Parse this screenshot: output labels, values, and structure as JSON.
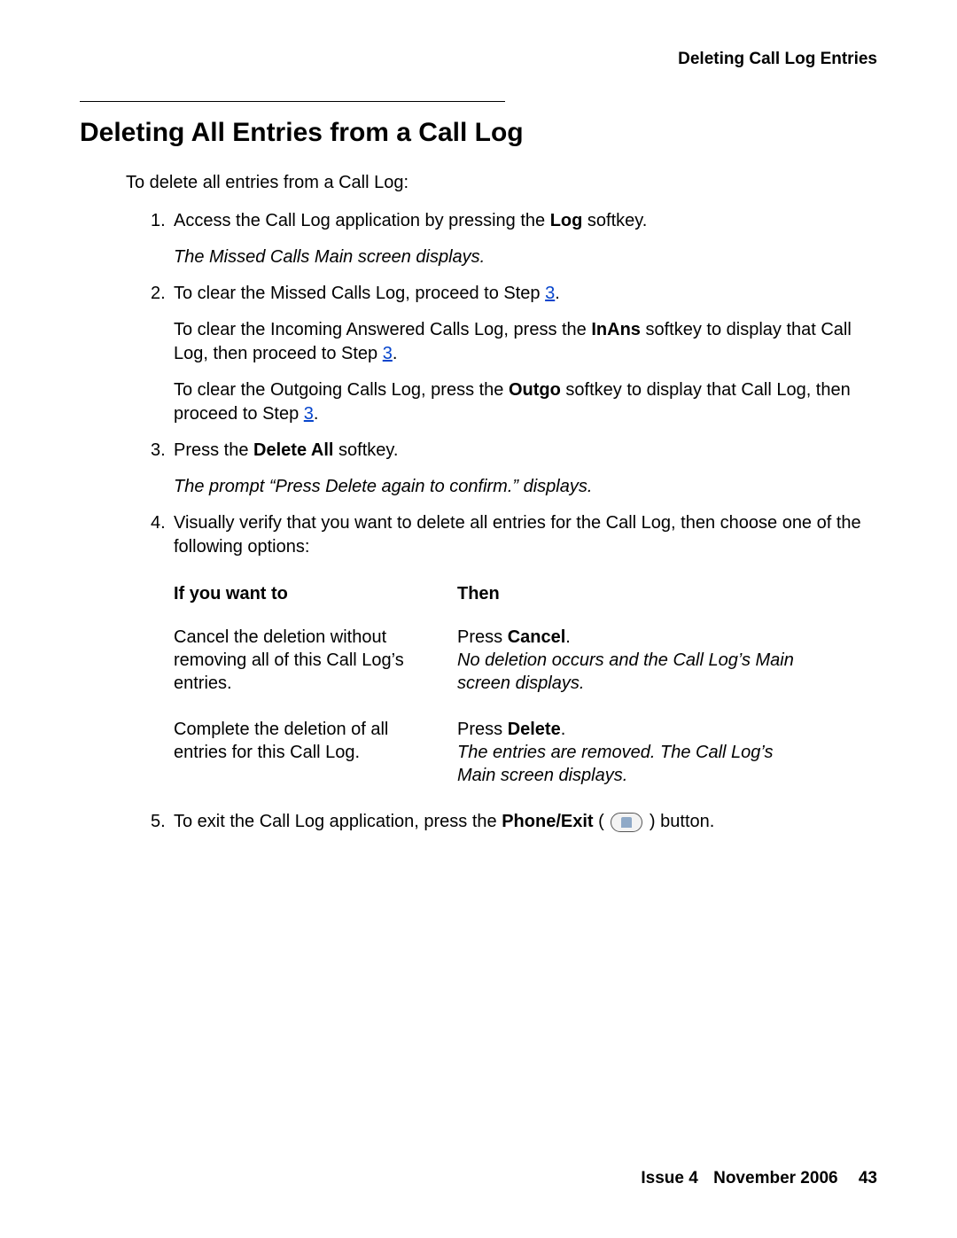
{
  "header": {
    "running_title": "Deleting Call Log Entries"
  },
  "section": {
    "title": "Deleting All Entries from a Call Log",
    "intro": "To delete all entries from a Call Log:"
  },
  "steps": {
    "s1": {
      "num": "1.",
      "pre": "Access the Call Log application by pressing the ",
      "bold": "Log",
      "post": " softkey.",
      "result": "The Missed Calls Main screen displays."
    },
    "s2": {
      "num": "2.",
      "pre": "To clear the Missed Calls Log, proceed to Step ",
      "link": "3",
      "post": ".",
      "p2_pre": "To clear the Incoming Answered Calls Log, press the ",
      "p2_bold": "InAns",
      "p2_mid": " softkey to display that Call Log, then proceed to Step ",
      "p2_link": "3",
      "p2_post": ".",
      "p3_pre": "To clear the Outgoing Calls Log, press the ",
      "p3_bold": "Outgo",
      "p3_mid": " softkey to display that Call Log, then proceed to Step ",
      "p3_link": "3",
      "p3_post": "."
    },
    "s3": {
      "num": "3.",
      "pre": "Press the ",
      "bold": "Delete All",
      "post": " softkey.",
      "result": "The prompt “Press Delete again to confirm.” displays."
    },
    "s4": {
      "num": "4.",
      "text": "Visually verify that you want to delete all entries for the Call Log, then choose one of the following options:"
    },
    "s5": {
      "num": "5.",
      "pre": "To exit the Call Log application, press the ",
      "bold": "Phone/Exit",
      "mid_open": " ( ",
      "mid_close": " ) ",
      "post": "button."
    }
  },
  "table": {
    "h1": "If you want to",
    "h2": "Then",
    "rows": [
      {
        "want": "Cancel the deletion without removing all of this Call Log’s entries.",
        "then_pre": "Press ",
        "then_bold": "Cancel",
        "then_post": ".",
        "then_result": "No deletion occurs and the Call Log’s Main screen displays."
      },
      {
        "want": "Complete the deletion of all entries for this Call Log.",
        "then_pre": "Press ",
        "then_bold": "Delete",
        "then_post": ".",
        "then_result": "The entries are removed. The Call Log’s Main screen displays."
      }
    ]
  },
  "footer": {
    "issue": "Issue 4",
    "date": "November 2006",
    "page": "43"
  }
}
